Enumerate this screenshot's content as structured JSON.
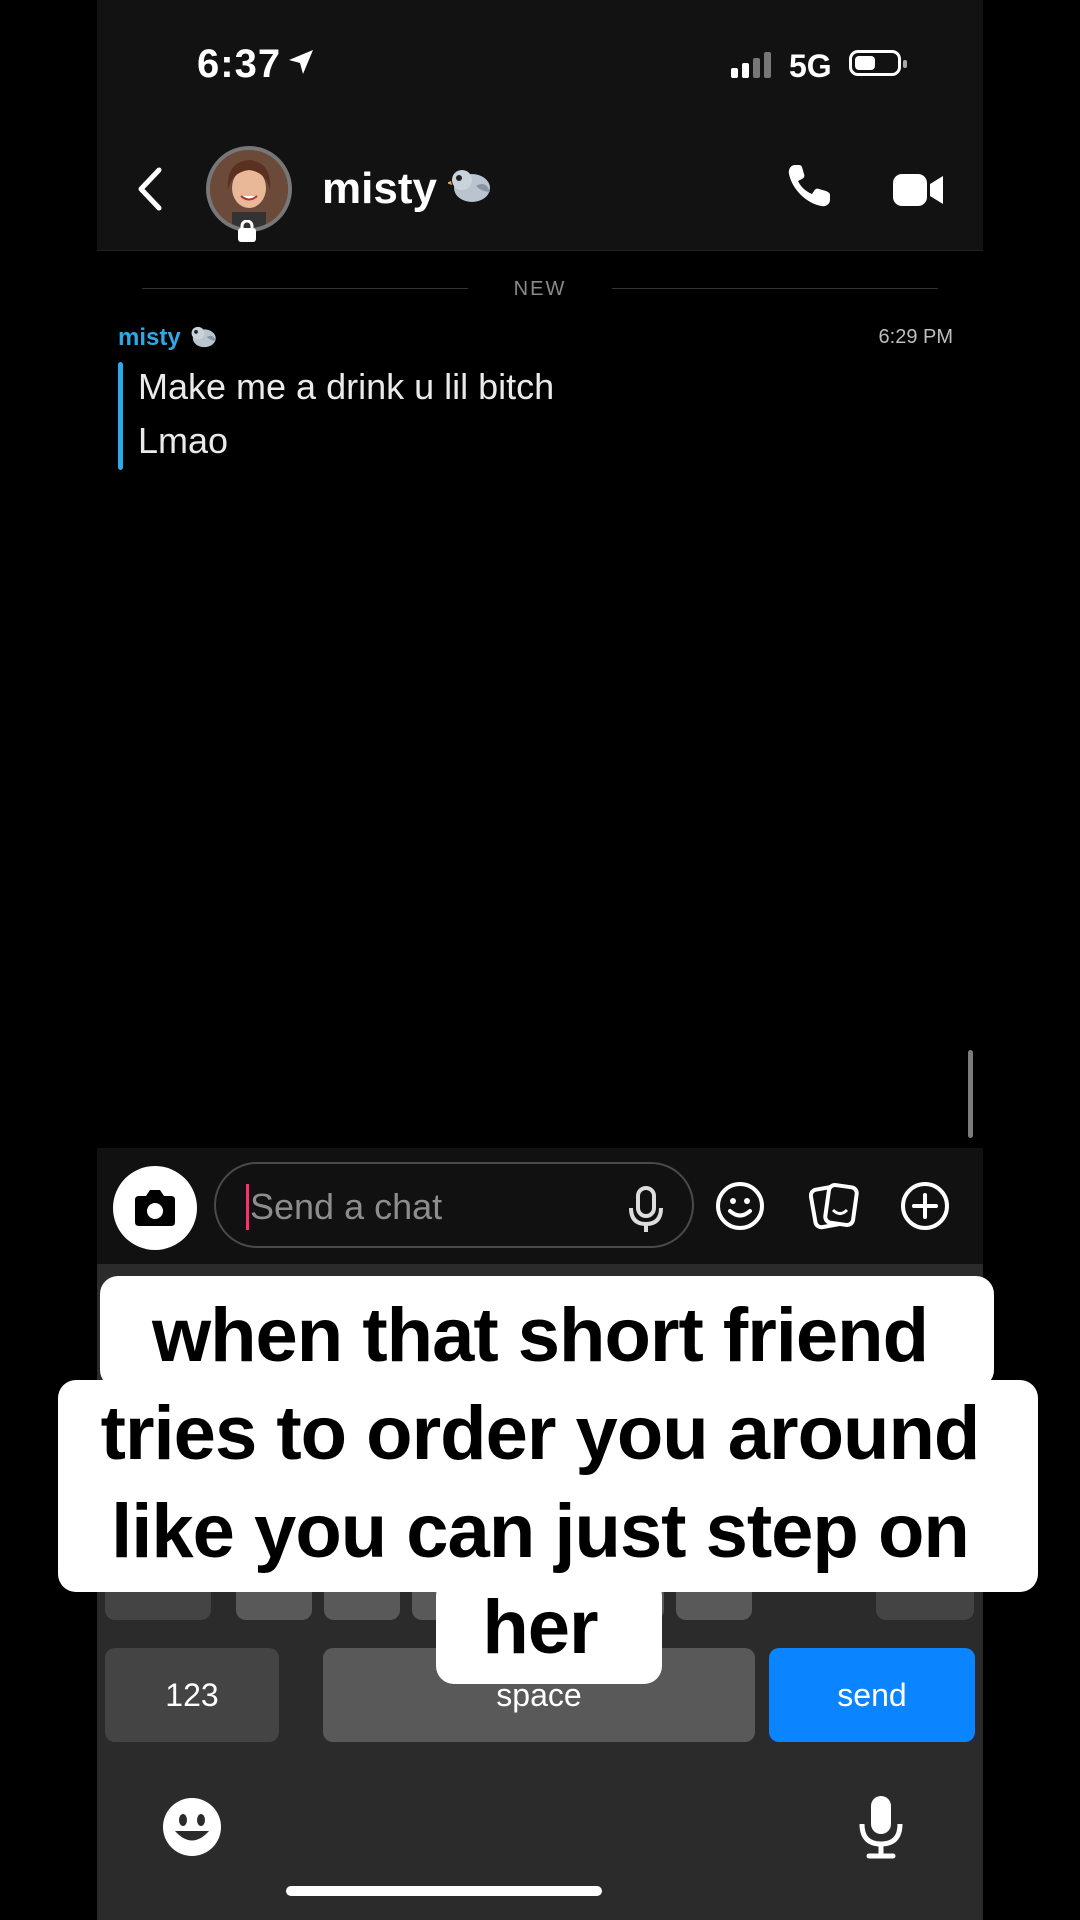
{
  "status_bar": {
    "time": "6:37",
    "network": "5G",
    "location_icon": "location-arrow-icon",
    "signal_icon": "signal-bars-icon",
    "battery_icon": "battery-icon"
  },
  "header": {
    "back_icon": "chevron-left-icon",
    "contact_name": "misty",
    "contact_emoji": "bird-emoji",
    "call_icon": "phone-icon",
    "video_icon": "video-camera-icon"
  },
  "chat": {
    "separator_label": "NEW",
    "message": {
      "sender": "misty",
      "sender_emoji": "bird-emoji",
      "time": "6:29 PM",
      "lines": [
        "Make me a drink u lil bitch",
        "Lmao"
      ]
    }
  },
  "input_bar": {
    "placeholder": "Send a chat",
    "camera_icon": "camera-icon",
    "mic_icon": "microphone-icon",
    "emoji_icon": "smiley-icon",
    "sticker_icon": "sticker-icon",
    "plus_icon": "plus-circle-icon"
  },
  "keyboard": {
    "key_123": "123",
    "key_space": "space",
    "key_send": "send",
    "emoji_icon": "emoji-icon",
    "dictation_icon": "microphone-icon"
  },
  "caption": {
    "lines": [
      "when that short friend",
      "tries to order you around",
      "like you can just step on",
      "her"
    ]
  },
  "colors": {
    "accent_blue": "#2ea8e6",
    "send_blue": "#0a84ff",
    "caret_pink": "#ff2e6e",
    "background": "#000000"
  }
}
